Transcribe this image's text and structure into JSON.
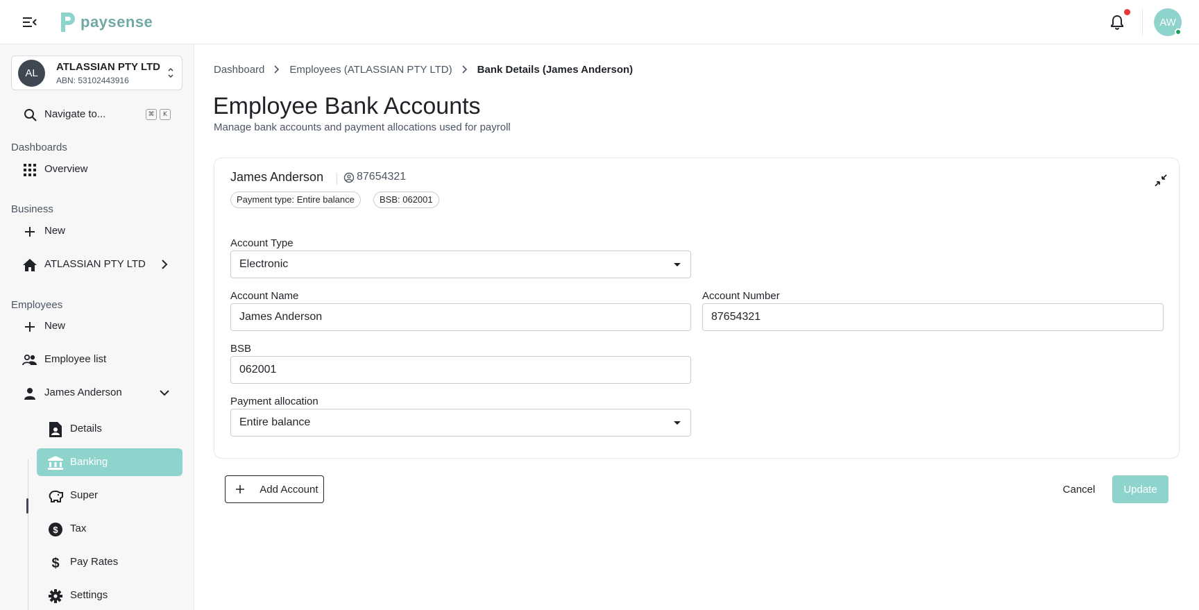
{
  "topbar": {
    "brand": "paysense",
    "avatar_initials": "AW",
    "notification_dot": true,
    "accent_color": "#8fd3cd"
  },
  "sidebar": {
    "org": {
      "initials": "AL",
      "name": "ATLASSIAN PTY LTD",
      "abn": "ABN: 53102443916"
    },
    "search": {
      "label": "Navigate to...",
      "shortcut_keys": [
        "⌘",
        "K"
      ]
    },
    "sections": {
      "dashboards": "Dashboards",
      "business": "Business",
      "employees": "Employees"
    },
    "items": {
      "overview": "Overview",
      "business_new": "New",
      "business_org": "ATLASSIAN PTY LTD",
      "employees_new": "New",
      "employee_list": "Employee list",
      "employee_current": "James Anderson"
    },
    "employee_subitems": [
      {
        "label": "Details",
        "icon": "document-person-icon",
        "active": false
      },
      {
        "label": "Banking",
        "icon": "bank-icon",
        "active": true
      },
      {
        "label": "Super",
        "icon": "piggy-bank-icon",
        "active": false
      },
      {
        "label": "Tax",
        "icon": "dollar-circle-icon",
        "active": false
      },
      {
        "label": "Pay Rates",
        "icon": "dollar-icon",
        "active": false
      },
      {
        "label": "Settings",
        "icon": "gear-icon",
        "active": false
      }
    ]
  },
  "breadcrumb": [
    "Dashboard",
    "Employees (ATLASSIAN PTY LTD)",
    "Bank Details (James Anderson)"
  ],
  "page": {
    "title": "Employee Bank Accounts",
    "subtitle": "Manage bank accounts and payment allocations used for payroll"
  },
  "account_card": {
    "name": "James Anderson",
    "account_number_display": "87654321",
    "chips": [
      "Payment type: Entire balance",
      "BSB: 062001"
    ],
    "fields": {
      "account_type": {
        "label": "Account Type",
        "value": "Electronic"
      },
      "account_name": {
        "label": "Account Name",
        "value": "James Anderson"
      },
      "account_number": {
        "label": "Account Number",
        "value": "87654321"
      },
      "bsb": {
        "label": "BSB",
        "value": "062001"
      },
      "payment_allocation": {
        "label": "Payment allocation",
        "value": "Entire balance"
      }
    }
  },
  "actions": {
    "add_account": "Add Account",
    "cancel": "Cancel",
    "update": "Update"
  }
}
